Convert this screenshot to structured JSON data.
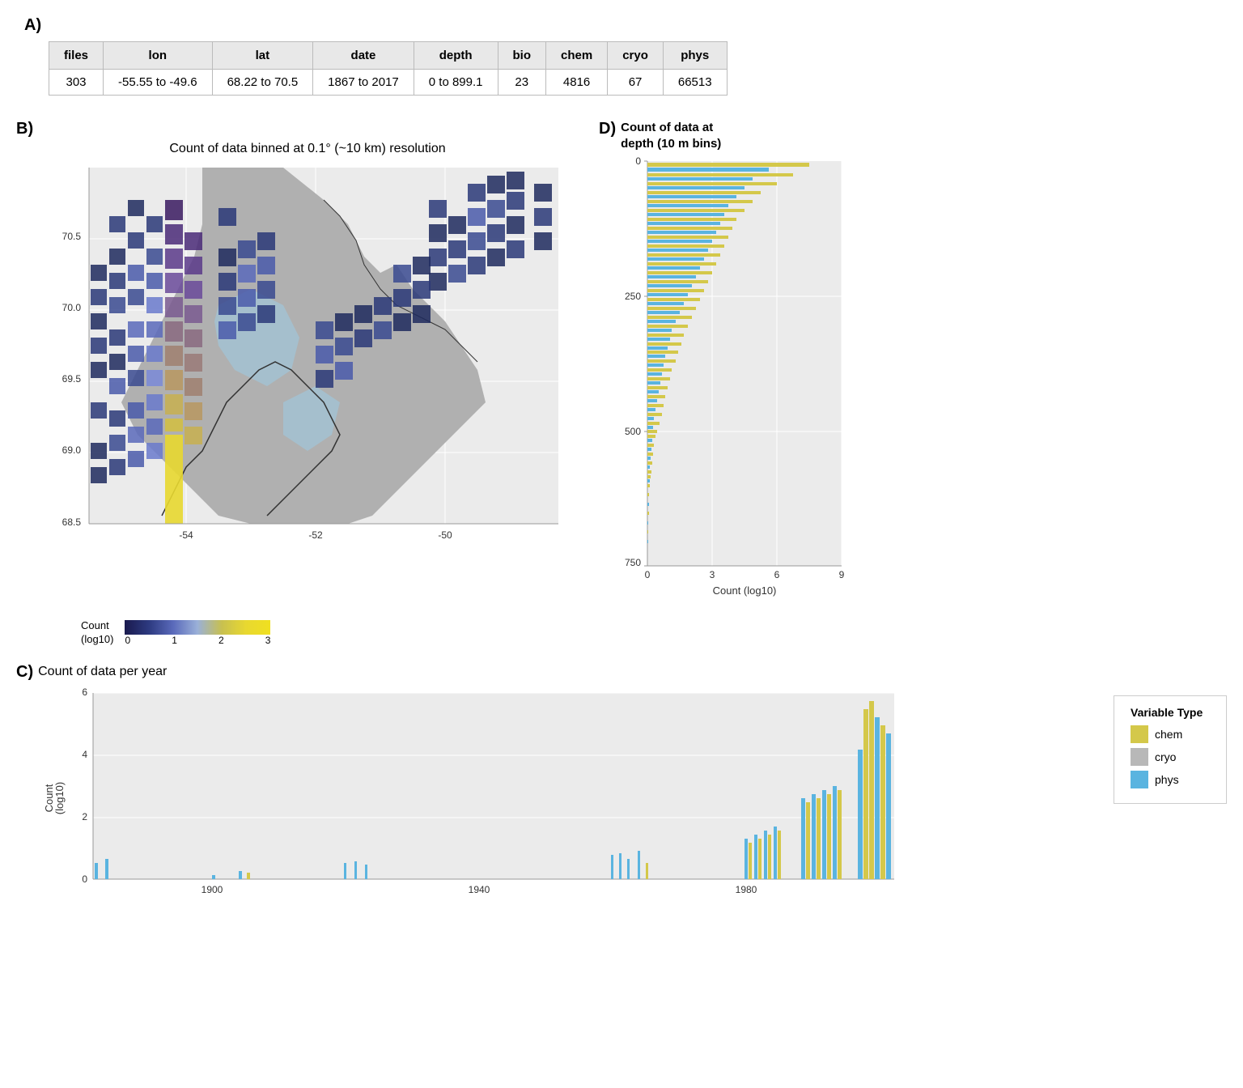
{
  "sectionA": {
    "label": "A)",
    "table": {
      "headers": [
        "files",
        "lon",
        "lat",
        "date",
        "depth",
        "bio",
        "chem",
        "cryo",
        "phys"
      ],
      "rows": [
        [
          "303",
          "-55.55 to -49.6",
          "68.22 to 70.5",
          "1867 to 2017",
          "0 to 899.1",
          "23",
          "4816",
          "67",
          "66513"
        ]
      ]
    }
  },
  "sectionB": {
    "label": "B)",
    "mapTitle": "Count of data binned at 0.1° (~10 km) resolution",
    "legend": {
      "title": "Count\n(log10)",
      "ticks": [
        "0",
        "1",
        "2",
        "3"
      ]
    },
    "xAxisTicks": [
      "-54",
      "-52",
      "-50"
    ],
    "yAxisTicks": [
      "68.5",
      "69.0",
      "69.5",
      "70.0",
      "70.5"
    ]
  },
  "sectionD": {
    "label": "D)",
    "title": "Count of data at\ndepth (10 m bins)",
    "yAxisTicks": [
      "0",
      "250",
      "500",
      "750"
    ],
    "xAxisTicks": [
      "0",
      "3",
      "6",
      "9"
    ],
    "xAxisLabel": "Count (log10)"
  },
  "sectionC": {
    "label": "C)",
    "title": "Count of data per year",
    "yAxisLabel": "Count\n(log10)",
    "yAxisTicks": [
      "0",
      "2",
      "4",
      "6"
    ],
    "xAxisTicks": [
      "1900",
      "1940",
      "1980"
    ]
  },
  "legend": {
    "title": "Variable Type",
    "items": [
      {
        "label": "chem",
        "color": "#d4c84a"
      },
      {
        "label": "cryo",
        "color": "#b0b0b0"
      },
      {
        "label": "phys",
        "color": "#5ab4e0"
      }
    ]
  },
  "colors": {
    "chem": "#d4c84a",
    "cryo": "#b8b8b8",
    "phys": "#5ab4e0",
    "mapLow": "#1a1a4e",
    "mapHigh": "#f0d020",
    "tableHeader": "#e8e8e8",
    "chartBg": "#ebebeb"
  }
}
